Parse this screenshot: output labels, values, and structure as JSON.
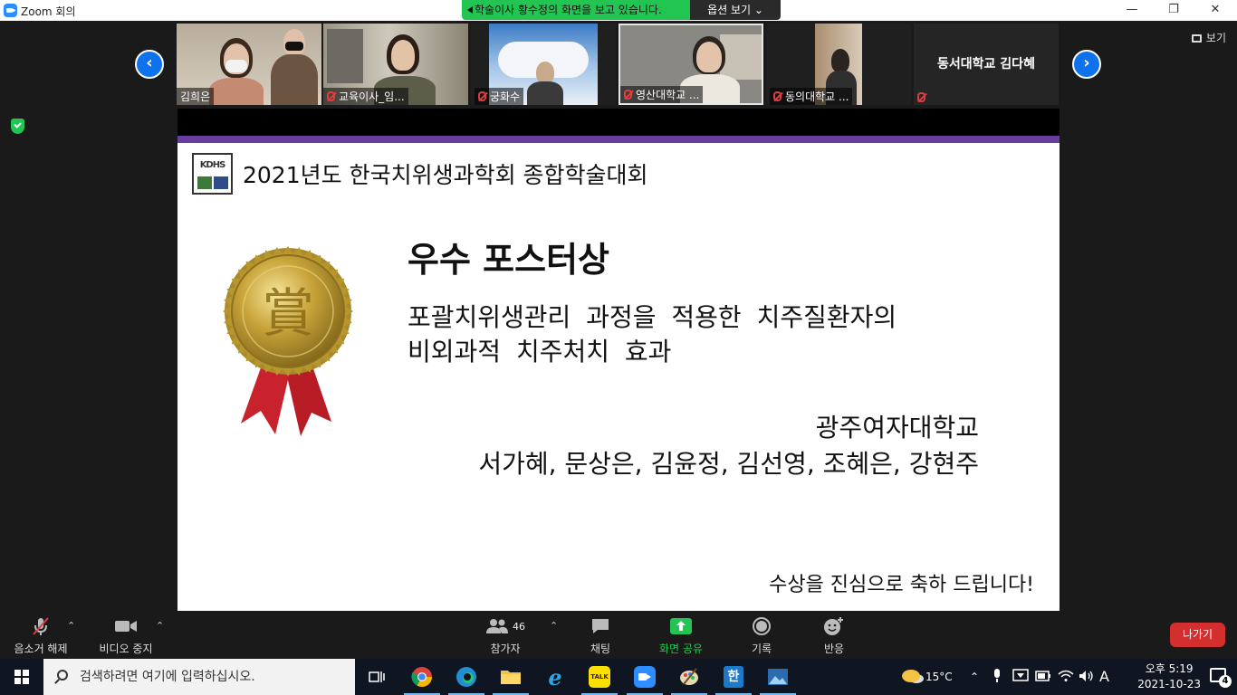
{
  "window": {
    "title": "Zoom 회의",
    "minimize": "—",
    "maximize": "❐",
    "close": "✕"
  },
  "share_banner": {
    "message": "학술이사 황수정의 화면을 보고 있습니다.",
    "options": "옵션 보기 ⌄"
  },
  "strip": {
    "view_label": "보기",
    "participants": [
      {
        "name": "김희은",
        "muted": false
      },
      {
        "name": "교육이사_임...",
        "muted": true
      },
      {
        "name": "궁화수",
        "muted": true
      },
      {
        "name": "영산대학교 ...",
        "muted": true
      },
      {
        "name": "동의대학교 ...",
        "muted": true
      },
      {
        "name": "동서대학교 김다혜",
        "muted": true
      }
    ]
  },
  "slide": {
    "header": "2021년도 한국치위생과학회 종합학술대회",
    "logo_text": "KDHS",
    "medal_character": "賞",
    "award_title": "우수 포스터상",
    "poster_title_line1": "포괄치위생관리 과정을 적용한 치주질환자의",
    "poster_title_line2": "비외과적 치주처치 효과",
    "affiliation": "광주여자대학교",
    "authors": "서가혜, 문상은, 김윤정, 김선영, 조혜은, 강현주",
    "congrats": "수상을 진심으로 축하 드립니다!"
  },
  "controls": {
    "unmute": "음소거 해제",
    "stop_video": "비디오 중지",
    "participants": "참가자",
    "participants_count": "46",
    "chat": "채팅",
    "share_screen": "화면 공유",
    "record": "기록",
    "reactions": "반응",
    "leave": "나가기"
  },
  "taskbar": {
    "search_placeholder": "검색하려면 여기에 입력하십시오.",
    "weather": "15°C",
    "ime": "A",
    "time": "오후 5:19",
    "date": "2021-10-23",
    "notifications": "4"
  },
  "colors": {
    "zoom_blue": "#0e72ed",
    "share_green": "#23c552",
    "leave_red": "#d32f2f",
    "slide_bar_purple": "#6a3ea1"
  }
}
